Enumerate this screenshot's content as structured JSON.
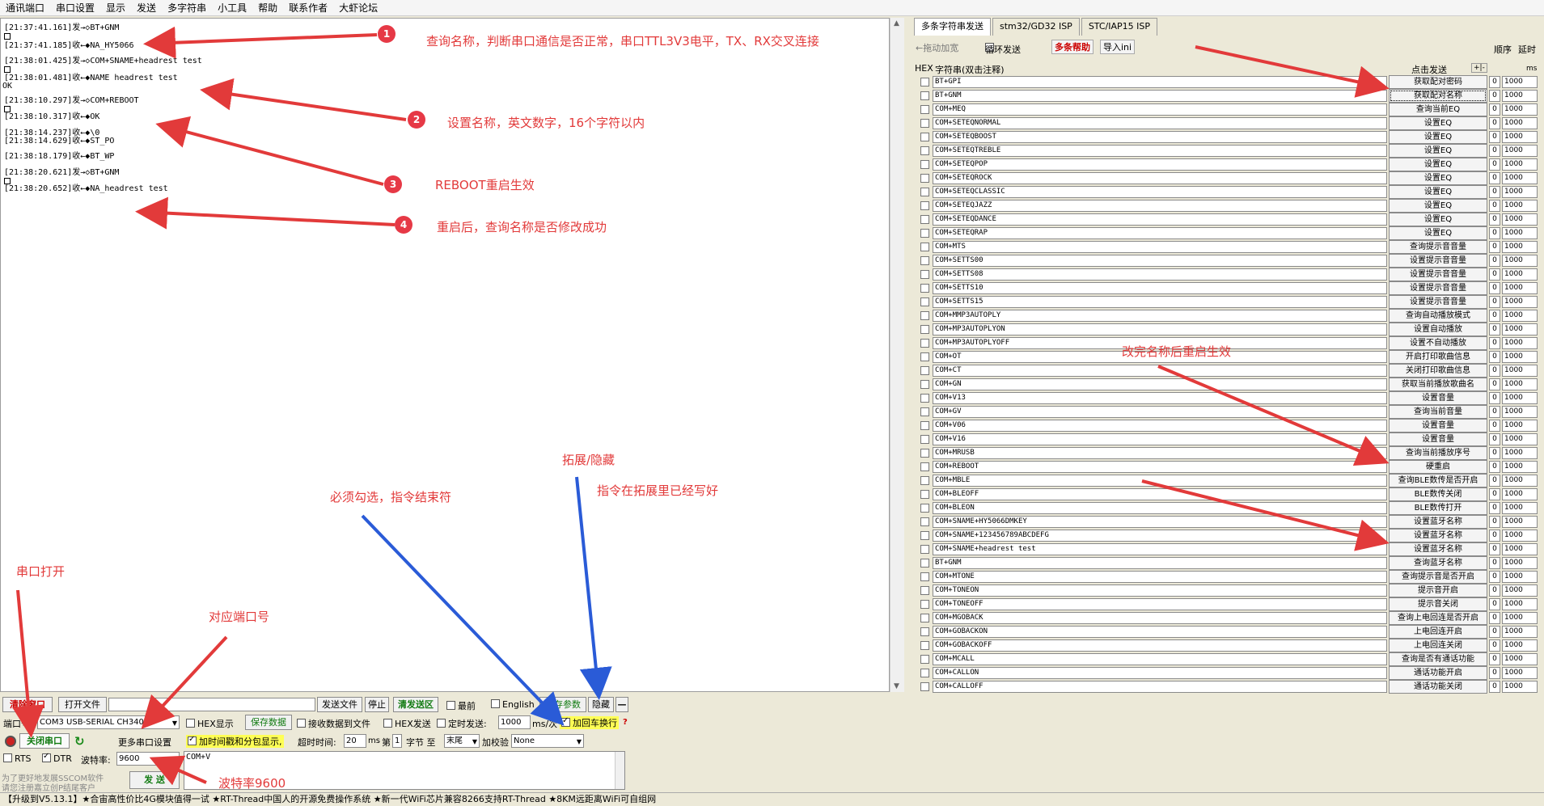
{
  "menu": [
    "通讯端口",
    "串口设置",
    "显示",
    "发送",
    "多字符串",
    "小工具",
    "帮助",
    "联系作者",
    "大虾论坛"
  ],
  "log": {
    "l1": "[21:37:41.161]发→◇BT+GNM",
    "l2": "[21:37:41.185]收←◆NA_HY5066",
    "l3": "[21:38:01.425]发→◇COM+SNAME+headrest test",
    "l4": "[21:38:01.481]收←◆NAME headrest test",
    "ok1": "OK",
    "l5": "[21:38:10.297]发→◇COM+REBOOT",
    "l6": "[21:38:10.317]收←◆OK",
    "l7": "[21:38:14.237]收←◆\\0",
    "l8": "[21:38:14.629]收←◆ST_PO",
    "l9": "[21:38:18.179]收←◆BT_WP",
    "l10": "[21:38:20.621]发→◇BT+GNM",
    "l11": "[21:38:20.652]收←◆NA_headrest test"
  },
  "annotations": {
    "n1": "1",
    "n2": "2",
    "n3": "3",
    "n4": "4",
    "a1": "查询名称，判断串口通信是否正常，串口TTL3V3电平，TX、RX交叉连接",
    "a2": "设置名称，英文数字，16个字符以内",
    "a3": "REBOOT重启生效",
    "a4": "重启后，查询名称是否修改成功",
    "a5": "改完名称后重启生效",
    "a6": "拓展/隐藏",
    "a7": "指令在拓展里已经写好",
    "a8": "必须勾选，指令结束符",
    "a9": "串口打开",
    "a10": "对应端口号",
    "a11": "波特率9600"
  },
  "right": {
    "tabs": [
      "多条字符串发送",
      "stm32/GD32 ISP",
      "STC/IAP15 ISP"
    ],
    "drag_add": "←拖动加宽",
    "loop_send": "循环发送",
    "multi_help": "多条帮助",
    "import_ini": "导入ini",
    "order": "顺序",
    "delay": "延时",
    "hex_label": "HEX",
    "string_label": "字符串(双击注释)",
    "click_send": "点击发送",
    "plus_minus": "+|-",
    "ms": "ms",
    "rows": [
      {
        "cmd": "BT+GPI",
        "btn": "获取配对密码",
        "ord": "0",
        "delay": "1000"
      },
      {
        "cmd": "BT+GNM",
        "btn": "获取配对名称",
        "ord": "0",
        "delay": "1000"
      },
      {
        "cmd": "COM+MEQ",
        "btn": "查询当前EQ",
        "ord": "0",
        "delay": "1000"
      },
      {
        "cmd": "COM+SETEQNORMAL",
        "btn": "设置EQ",
        "ord": "0",
        "delay": "1000"
      },
      {
        "cmd": "COM+SETEQBOOST",
        "btn": "设置EQ",
        "ord": "0",
        "delay": "1000"
      },
      {
        "cmd": "COM+SETEQTREBLE",
        "btn": "设置EQ",
        "ord": "0",
        "delay": "1000"
      },
      {
        "cmd": "COM+SETEQPOP",
        "btn": "设置EQ",
        "ord": "0",
        "delay": "1000"
      },
      {
        "cmd": "COM+SETEQROCK",
        "btn": "设置EQ",
        "ord": "0",
        "delay": "1000"
      },
      {
        "cmd": "COM+SETEQCLASSIC",
        "btn": "设置EQ",
        "ord": "0",
        "delay": "1000"
      },
      {
        "cmd": "COM+SETEQJAZZ",
        "btn": "设置EQ",
        "ord": "0",
        "delay": "1000"
      },
      {
        "cmd": "COM+SETEQDANCE",
        "btn": "设置EQ",
        "ord": "0",
        "delay": "1000"
      },
      {
        "cmd": "COM+SETEQRAP",
        "btn": "设置EQ",
        "ord": "0",
        "delay": "1000"
      },
      {
        "cmd": "COM+MTS",
        "btn": "查询提示音音量",
        "ord": "0",
        "delay": "1000"
      },
      {
        "cmd": "COM+SETTS00",
        "btn": "设置提示音音量",
        "ord": "0",
        "delay": "1000"
      },
      {
        "cmd": "COM+SETTS08",
        "btn": "设置提示音音量",
        "ord": "0",
        "delay": "1000"
      },
      {
        "cmd": "COM+SETTS10",
        "btn": "设置提示音音量",
        "ord": "0",
        "delay": "1000"
      },
      {
        "cmd": "COM+SETTS15",
        "btn": "设置提示音音量",
        "ord": "0",
        "delay": "1000"
      },
      {
        "cmd": "COM+MMP3AUTOPLY",
        "btn": "查询自动播放模式",
        "ord": "0",
        "delay": "1000"
      },
      {
        "cmd": "COM+MP3AUTOPLYON",
        "btn": "设置自动播放",
        "ord": "0",
        "delay": "1000"
      },
      {
        "cmd": "COM+MP3AUTOPLYOFF",
        "btn": "设置不自动播放",
        "ord": "0",
        "delay": "1000"
      },
      {
        "cmd": "COM+OT",
        "btn": "开启打印歌曲信息",
        "ord": "0",
        "delay": "1000"
      },
      {
        "cmd": "COM+CT",
        "btn": "关闭打印歌曲信息",
        "ord": "0",
        "delay": "1000"
      },
      {
        "cmd": "COM+GN",
        "btn": "获取当前播放歌曲名",
        "ord": "0",
        "delay": "1000"
      },
      {
        "cmd": "COM+V13",
        "btn": "设置音量",
        "ord": "0",
        "delay": "1000"
      },
      {
        "cmd": "COM+GV",
        "btn": "查询当前音量",
        "ord": "0",
        "delay": "1000"
      },
      {
        "cmd": "COM+V06",
        "btn": "设置音量",
        "ord": "0",
        "delay": "1000"
      },
      {
        "cmd": "COM+V16",
        "btn": "设置音量",
        "ord": "0",
        "delay": "1000"
      },
      {
        "cmd": "COM+MRUSB",
        "btn": "查询当前播放序号",
        "ord": "0",
        "delay": "1000"
      },
      {
        "cmd": "COM+REBOOT",
        "btn": "硬重启",
        "ord": "0",
        "delay": "1000"
      },
      {
        "cmd": "COM+MBLE",
        "btn": "查询BLE数传是否开启",
        "ord": "0",
        "delay": "1000"
      },
      {
        "cmd": "COM+BLEOFF",
        "btn": "BLE数传关闭",
        "ord": "0",
        "delay": "1000"
      },
      {
        "cmd": "COM+BLEON",
        "btn": "BLE数传打开",
        "ord": "0",
        "delay": "1000"
      },
      {
        "cmd": "COM+SNAME+HY5066DMKEY",
        "btn": "设置蓝牙名称",
        "ord": "0",
        "delay": "1000"
      },
      {
        "cmd": "COM+SNAME+123456789ABCDEFG",
        "btn": "设置蓝牙名称",
        "ord": "0",
        "delay": "1000"
      },
      {
        "cmd": "COM+SNAME+headrest test",
        "btn": "设置蓝牙名称",
        "ord": "0",
        "delay": "1000"
      },
      {
        "cmd": "BT+GNM",
        "btn": "查询蓝牙名称",
        "ord": "0",
        "delay": "1000"
      },
      {
        "cmd": "COM+MTONE",
        "btn": "查询提示音是否开启",
        "ord": "0",
        "delay": "1000"
      },
      {
        "cmd": "COM+TONEON",
        "btn": "提示音开启",
        "ord": "0",
        "delay": "1000"
      },
      {
        "cmd": "COM+TONEOFF",
        "btn": "提示音关闭",
        "ord": "0",
        "delay": "1000"
      },
      {
        "cmd": "COM+MGOBACK",
        "btn": "查询上电回连是否开启",
        "ord": "0",
        "delay": "1000"
      },
      {
        "cmd": "COM+GOBACKON",
        "btn": "上电回连开启",
        "ord": "0",
        "delay": "1000"
      },
      {
        "cmd": "COM+GOBACKOFF",
        "btn": "上电回连关闭",
        "ord": "0",
        "delay": "1000"
      },
      {
        "cmd": "COM+MCALL",
        "btn": "查询是否有通话功能",
        "ord": "0",
        "delay": "1000"
      },
      {
        "cmd": "COM+CALLON",
        "btn": "通话功能开启",
        "ord": "0",
        "delay": "1000"
      },
      {
        "cmd": "COM+CALLOFF",
        "btn": "通话功能关闭",
        "ord": "0",
        "delay": "1000"
      }
    ]
  },
  "bottom": {
    "clear_window": "清除窗口",
    "open_file": "打开文件",
    "send_file": "发送文件",
    "stop": "停止",
    "clear_send": "清发送区",
    "topmost": "最前",
    "english": "English",
    "save_params": "保存参数",
    "expand_hide": "隐藏",
    "port_label": "端口号",
    "port_value": "COM3 USB-SERIAL CH340",
    "hex_display": "HEX显示",
    "save_data": "保存数据",
    "recv_to_file": "接收数据到文件",
    "hex_send": "HEX发送",
    "timed_send": "定时发送:",
    "timed_value": "1000",
    "timed_unit": "ms/次",
    "add_crlf": "加回车换行",
    "close_port": "关闭串口",
    "more_settings": "更多串口设置",
    "timestamp": "加时间戳和分包显示,",
    "timeout_label": "超时时间:",
    "timeout_value": "20",
    "timeout_unit": "ms",
    "byte_from_label": "第",
    "byte_from_value": "1",
    "byte_to_label": "字节 至",
    "byte_to_value": "末尾",
    "checksum_label": "加校验",
    "checksum_value": "None",
    "rts": "RTS",
    "dtr": "DTR",
    "baud_label": "波特率:",
    "baud_value": "9600",
    "send_text": "COM+V",
    "send_btn": "发 送",
    "promo1": "为了更好地发展SSCOM软件",
    "promo2": "请您注册嘉立创P结尾客户"
  },
  "status": "【升级到V5.13.1】★合宙高性价比4G模块值得一试 ★RT-Thread中国人的开源免费操作系统 ★新一代WiFi芯片兼容8266支持RT-Thread ★8KM远距离WiFi可自组网"
}
